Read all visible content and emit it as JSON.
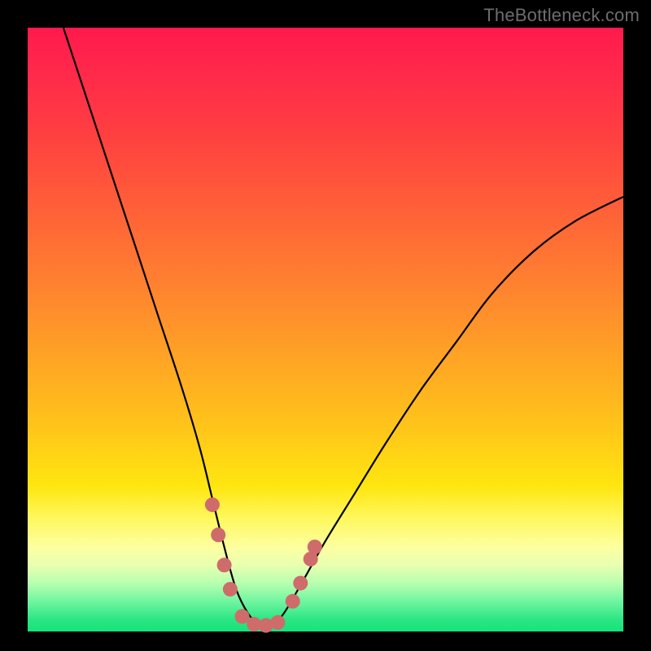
{
  "watermark": "TheBottleneck.com",
  "colors": {
    "background": "#000000",
    "curve": "#000000",
    "marker": "#cf6b6b"
  },
  "chart_data": {
    "type": "line",
    "title": "",
    "xlabel": "",
    "ylabel": "",
    "xlim": [
      0,
      100
    ],
    "ylim": [
      0,
      100
    ],
    "grid": false,
    "legend": false,
    "series": [
      {
        "name": "bottleneck-curve",
        "x": [
          6,
          10,
          14,
          18,
          22,
          26,
          29,
          31,
          33,
          35,
          37,
          39,
          41,
          43,
          46,
          50,
          55,
          60,
          66,
          72,
          78,
          85,
          92,
          100
        ],
        "y": [
          100,
          88,
          76,
          64,
          52,
          40,
          30,
          22,
          14,
          7,
          3,
          1,
          1,
          3,
          8,
          15,
          23,
          31,
          40,
          48,
          56,
          63,
          68,
          72
        ]
      }
    ],
    "annotations": [
      {
        "name": "marker-left-1",
        "x": 31.0,
        "y": 21
      },
      {
        "name": "marker-left-2",
        "x": 32.0,
        "y": 16
      },
      {
        "name": "marker-left-3",
        "x": 33.0,
        "y": 11
      },
      {
        "name": "marker-left-4",
        "x": 34.0,
        "y": 7
      },
      {
        "name": "marker-bottom-1",
        "x": 36.0,
        "y": 2.5
      },
      {
        "name": "marker-bottom-2",
        "x": 38.0,
        "y": 1.2
      },
      {
        "name": "marker-bottom-3",
        "x": 40.0,
        "y": 1.0
      },
      {
        "name": "marker-bottom-4",
        "x": 42.0,
        "y": 1.5
      },
      {
        "name": "marker-right-1",
        "x": 44.5,
        "y": 5
      },
      {
        "name": "marker-right-2",
        "x": 45.8,
        "y": 8
      },
      {
        "name": "marker-right-3",
        "x": 47.5,
        "y": 12
      },
      {
        "name": "marker-right-4",
        "x": 48.2,
        "y": 14
      }
    ]
  }
}
